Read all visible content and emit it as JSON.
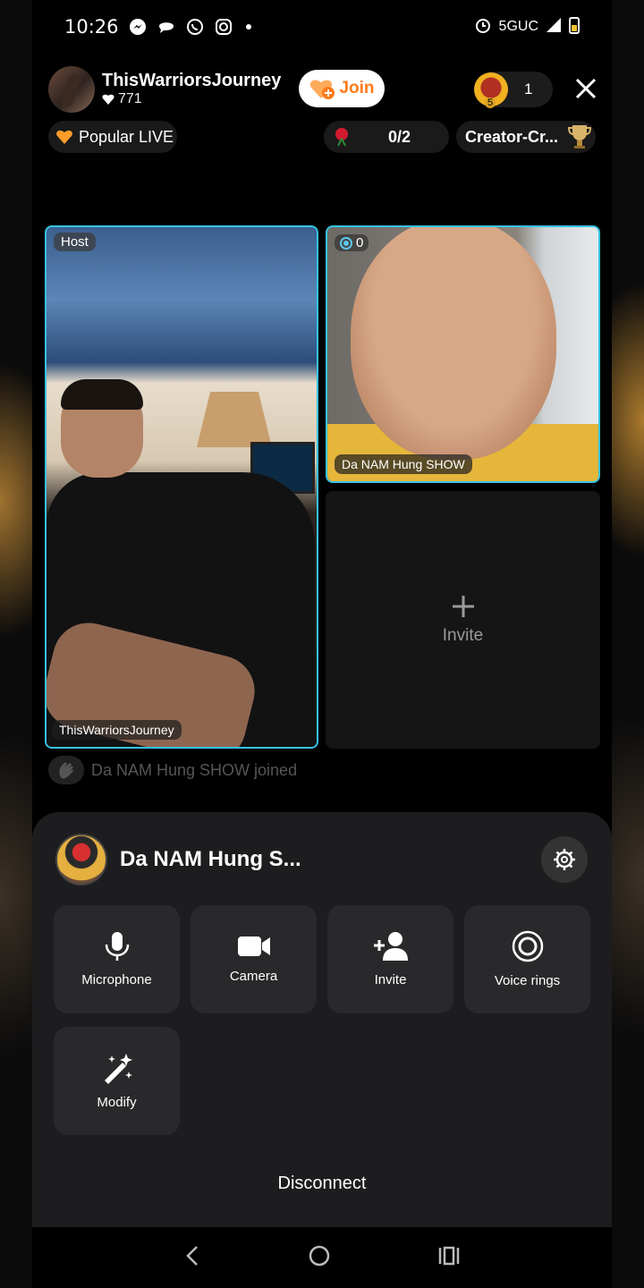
{
  "status_bar": {
    "time": "10:26",
    "network": "5GUC"
  },
  "header": {
    "host_name": "ThisWarriorsJourney",
    "host_likes": "771",
    "join_label": "Join",
    "viewer_badge": "5",
    "viewer_count": "1"
  },
  "chips": {
    "popular_label": "Popular LIVE",
    "gift_count": "0/2",
    "creator_label": "Creator-Cr..."
  },
  "grid": {
    "host_tag": "Host",
    "host_name": "ThisWarriorsJourney",
    "guest_counter": "0",
    "guest_name": "Da NAM Hung SHOW",
    "invite_label": "Invite"
  },
  "feed": {
    "joined_text": "Da NAM Hung SHOW joined"
  },
  "sheet": {
    "title": "Da NAM Hung S...",
    "actions": [
      {
        "label": "Microphone",
        "icon": "microphone-icon"
      },
      {
        "label": "Camera",
        "icon": "camera-icon"
      },
      {
        "label": "Invite",
        "icon": "add-user-icon"
      },
      {
        "label": "Voice rings",
        "icon": "voice-rings-icon"
      },
      {
        "label": "Modify",
        "icon": "magic-wand-icon"
      }
    ],
    "disconnect_label": "Disconnect"
  },
  "colors": {
    "accent_border": "#35c3e3",
    "join_text": "#ff7a1a",
    "sheet_bg": "#1d1d1f"
  }
}
